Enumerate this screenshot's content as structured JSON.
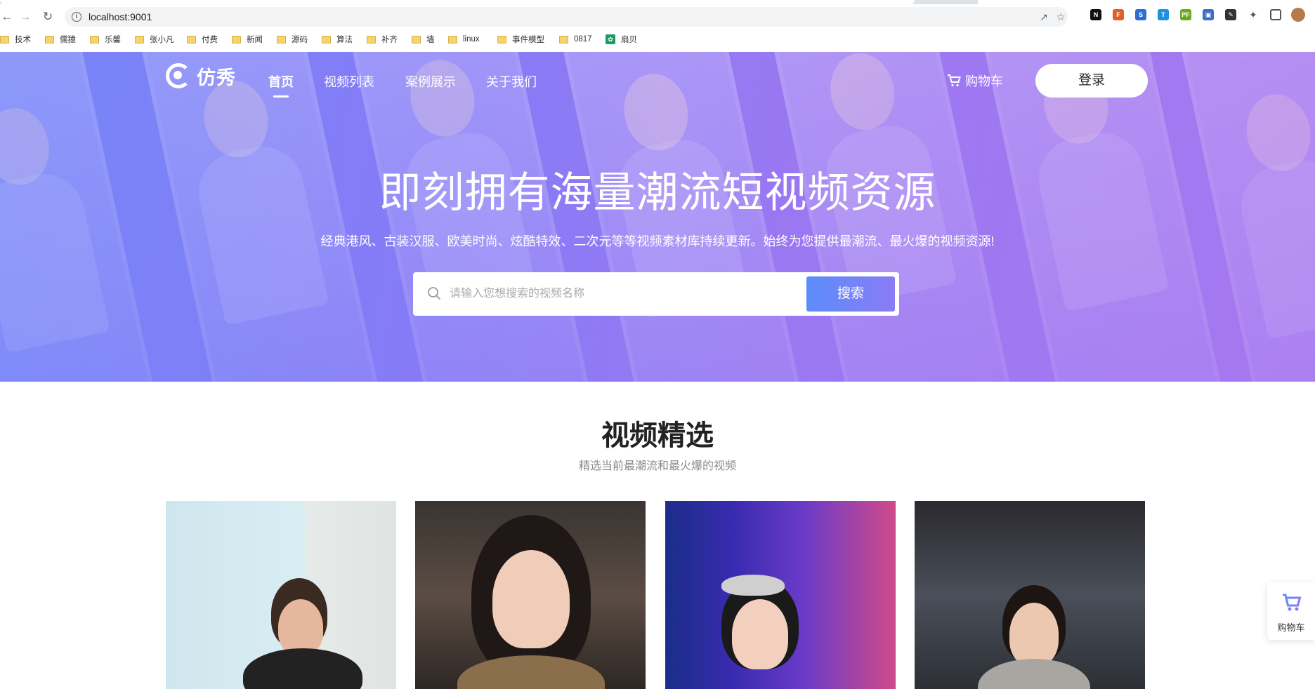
{
  "browser": {
    "url": "localhost:9001",
    "bookmarks": [
      "技术",
      "儒猿",
      "乐馨",
      "张小凡",
      "付费",
      "新闻",
      "源码",
      "算法",
      "补齐",
      "墙",
      "linux",
      "事件模型",
      "0817",
      "扇贝"
    ]
  },
  "nav": {
    "logo": "仿秀",
    "links": [
      "首页",
      "视频列表",
      "案例展示",
      "关于我们"
    ],
    "active_index": 0,
    "cart": "购物车",
    "login": "登录"
  },
  "hero": {
    "title": "即刻拥有海量潮流短视频资源",
    "subtitle": "经典港风、古装汉服、欧美时尚、炫酷特效、二次元等等视频素材库持续更新。始终为您提供最潮流、最火爆的视频资源!",
    "search_placeholder": "请输入您想搜索的视频名称",
    "search_button": "搜索"
  },
  "section": {
    "title": "视频精选",
    "subtitle": "精选当前最潮流和最火爆的视频"
  },
  "float_cart": {
    "label": "购物车"
  },
  "colors": {
    "accent_start": "#5c8cfb",
    "accent_end": "#8a7bf5",
    "hero_bg": "#8a7cf6"
  }
}
